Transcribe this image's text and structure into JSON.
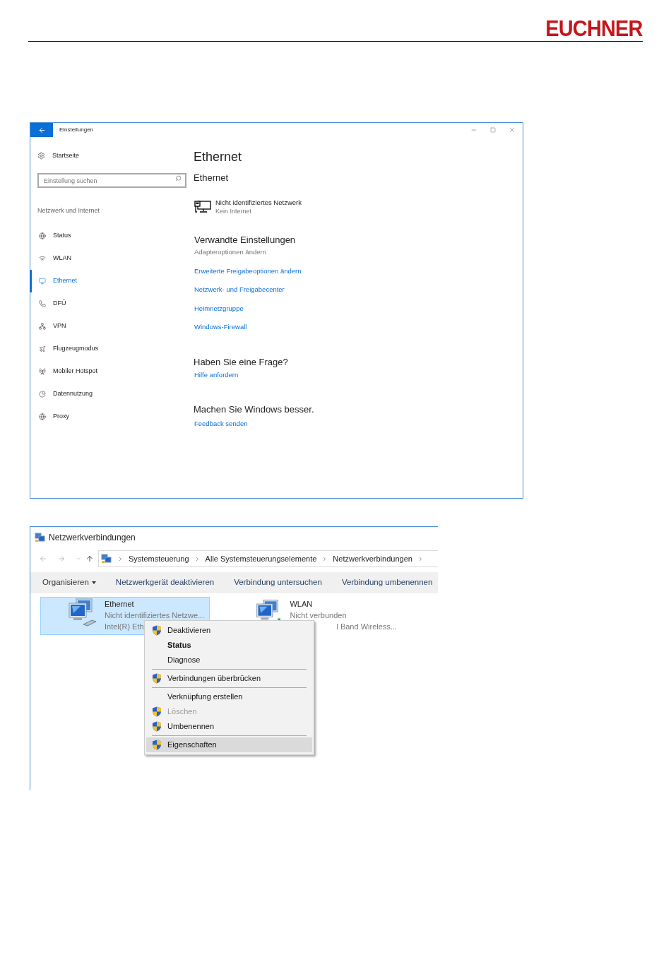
{
  "header": {
    "logo": "EUCHNER"
  },
  "settings_window": {
    "title": "Einstellungen",
    "home": "Startseite",
    "search": {
      "placeholder": "Einstellung suchen"
    },
    "section": "Netzwerk und Internet",
    "nav": [
      {
        "label": "Status",
        "kind": "status",
        "selected": false
      },
      {
        "label": "WLAN",
        "kind": "wifi",
        "selected": false
      },
      {
        "label": "Ethernet",
        "kind": "ethernet",
        "selected": true
      },
      {
        "label": "DFÜ",
        "kind": "phone",
        "selected": false
      },
      {
        "label": "VPN",
        "kind": "vpn",
        "selected": false
      },
      {
        "label": "Flugzeugmodus",
        "kind": "plane",
        "selected": false
      },
      {
        "label": "Mobiler Hotspot",
        "kind": "hotspot",
        "selected": false
      },
      {
        "label": "Datennutzung",
        "kind": "data",
        "selected": false
      },
      {
        "label": "Proxy",
        "kind": "globe",
        "selected": false
      }
    ],
    "page_title": "Ethernet",
    "subtitle": "Ethernet",
    "network": {
      "name": "Nicht identifiziertes Netzwerk",
      "status": "Kein Internet"
    },
    "related": {
      "title": "Verwandte Einstellungen",
      "links": [
        {
          "label": "Adapteroptionen ändern",
          "disabled": true
        },
        {
          "label": "Erweiterte Freigabeoptionen ändern",
          "disabled": false
        },
        {
          "label": "Netzwerk- und Freigabecenter",
          "disabled": false
        },
        {
          "label": "Heimnetzgruppe",
          "disabled": false
        },
        {
          "label": "Windows-Firewall",
          "disabled": false
        }
      ]
    },
    "question": {
      "title": "Haben Sie eine Frage?",
      "link": "Hilfe anfordern"
    },
    "feedback": {
      "title": "Machen Sie Windows besser.",
      "link": "Feedback senden"
    }
  },
  "connections_window": {
    "title": "Netzwerkverbindungen",
    "breadcrumb": [
      "Systemsteuerung",
      "Alle Systemsteuerungselemente",
      "Netzwerkverbindungen"
    ],
    "toolbar": [
      {
        "label": "Organisieren",
        "dropdown": true
      },
      {
        "label": "Netzwerkgerät deaktivieren",
        "dropdown": false
      },
      {
        "label": "Verbindung untersuchen",
        "dropdown": false
      },
      {
        "label": "Verbindung umbenennen",
        "dropdown": false
      }
    ],
    "adapters": [
      {
        "name": "Ethernet",
        "status": "Nicht identifiziertes Netzwe...",
        "device": "Intel(R) Eth",
        "selected": true,
        "kind": "wired"
      },
      {
        "name": "WLAN",
        "status": "Nicht verbunden",
        "device": "l Band Wireless...",
        "selected": false,
        "kind": "wireless"
      }
    ],
    "context_menu": [
      {
        "kind": "item",
        "label": "Deaktivieren",
        "shield": true,
        "bold": false,
        "disabled": false,
        "selected": false
      },
      {
        "kind": "item",
        "label": "Status",
        "shield": false,
        "bold": true,
        "disabled": false,
        "selected": false
      },
      {
        "kind": "item",
        "label": "Diagnose",
        "shield": false,
        "bold": false,
        "disabled": false,
        "selected": false
      },
      {
        "kind": "separator"
      },
      {
        "kind": "item",
        "label": "Verbindungen überbrücken",
        "shield": true,
        "bold": false,
        "disabled": false,
        "selected": false
      },
      {
        "kind": "separator"
      },
      {
        "kind": "item",
        "label": "Verknüpfung erstellen",
        "shield": false,
        "bold": false,
        "disabled": false,
        "selected": false
      },
      {
        "kind": "item",
        "label": "Löschen",
        "shield": true,
        "bold": false,
        "disabled": true,
        "selected": false
      },
      {
        "kind": "item",
        "label": "Umbenennen",
        "shield": true,
        "bold": false,
        "disabled": false,
        "selected": false
      },
      {
        "kind": "separator"
      },
      {
        "kind": "item",
        "label": "Eigenschaften",
        "shield": true,
        "bold": false,
        "disabled": false,
        "selected": true
      }
    ]
  }
}
